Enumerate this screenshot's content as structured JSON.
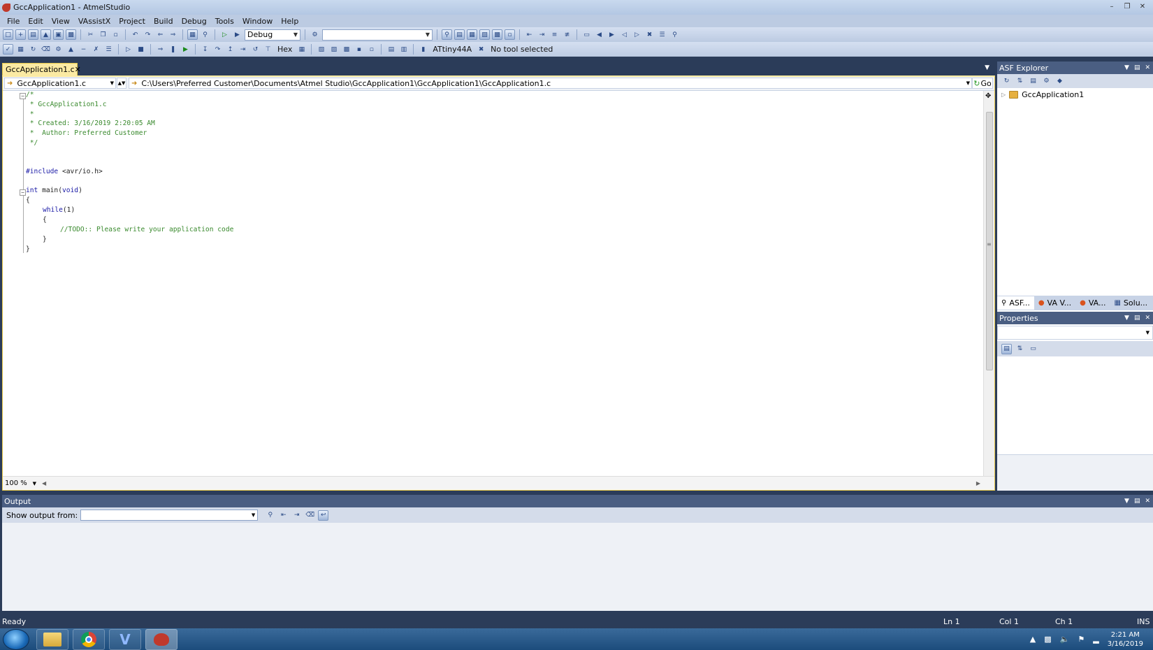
{
  "window": {
    "title": "GccApplication1 - AtmelStudio"
  },
  "menu": [
    "File",
    "Edit",
    "View",
    "VAssistX",
    "Project",
    "Build",
    "Debug",
    "Tools",
    "Window",
    "Help"
  ],
  "toolbar": {
    "config_combo": "Debug",
    "platform_combo": "",
    "hex_label": "Hex",
    "device_label": "ATtiny44A",
    "tool_label": "No tool selected"
  },
  "editor": {
    "tab_label": "GccApplication1.c",
    "nav_file": "GccApplication1.c",
    "nav_path": "C:\\Users\\Preferred Customer\\Documents\\Atmel Studio\\GccApplication1\\GccApplication1\\GccApplication1.c",
    "go_label": "Go",
    "zoom": "100 %",
    "code": {
      "l1": "/*",
      "l2": " * GccApplication1.c",
      "l3": " *",
      "l4": " * Created: 3/16/2019 2:20:05 AM",
      "l5": " *  Author: Preferred Customer",
      "l6": " */",
      "include_kw": "#include",
      "include_file": " <avr/io.h>",
      "int_kw": "int",
      "main_sig": " main(",
      "void_kw": "void",
      "main_close": ")",
      "brace_open": "{",
      "while_kw": "while",
      "while_cond": "(1)",
      "inner_open": "{",
      "todo": "//TODO:: Please write your application code",
      "inner_close": "}",
      "brace_close": "}"
    }
  },
  "asf_explorer": {
    "title": "ASF Explorer",
    "tree_item": "GccApplication1"
  },
  "panel_tabs": [
    "ASF...",
    "VA V...",
    "VA...",
    "Solu..."
  ],
  "properties": {
    "title": "Properties"
  },
  "output": {
    "title": "Output",
    "show_from_label": "Show output from:"
  },
  "status": {
    "ready": "Ready",
    "ln": "Ln 1",
    "col": "Col 1",
    "ch": "Ch 1",
    "ins": "INS"
  },
  "taskbar": {
    "time": "2:21 AM",
    "date": "3/16/2019"
  }
}
